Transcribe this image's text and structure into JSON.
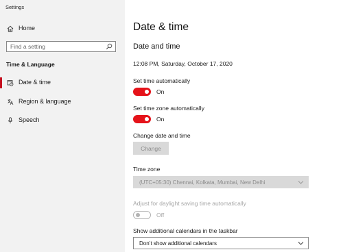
{
  "app": {
    "title": "Settings"
  },
  "sidebar": {
    "home_label": "Home",
    "search_placeholder": "Find a setting",
    "section_heading": "Time & Language",
    "items": [
      {
        "label": "Date & time",
        "icon": "date-time-icon",
        "selected": true
      },
      {
        "label": "Region & language",
        "icon": "region-language-icon",
        "selected": false
      },
      {
        "label": "Speech",
        "icon": "microphone-icon",
        "selected": false
      }
    ]
  },
  "main": {
    "page_title": "Date & time",
    "subheading": "Date and time",
    "current_datetime": "12:08 PM, Saturday, October 17, 2020",
    "set_time_auto": {
      "label": "Set time automatically",
      "state": "On",
      "on": true
    },
    "set_tz_auto": {
      "label": "Set time zone automatically",
      "state": "On",
      "on": true
    },
    "change_date_time": {
      "label": "Change date and time",
      "button": "Change",
      "enabled": false
    },
    "time_zone": {
      "label": "Time zone",
      "value": "(UTC+05:30) Chennai, Kolkata, Mumbai, New Delhi",
      "enabled": false
    },
    "daylight": {
      "label": "Adjust for daylight saving time automatically",
      "state": "Off",
      "on": false,
      "enabled": false
    },
    "calendars": {
      "label": "Show additional calendars in the taskbar",
      "value": "Don’t show additional calendars"
    }
  },
  "colors": {
    "accent": "#e5131a",
    "selection_indicator": "#c50f1f",
    "sidebar_bg": "#f2f2f2",
    "disabled_bg": "#d9d9d9"
  }
}
